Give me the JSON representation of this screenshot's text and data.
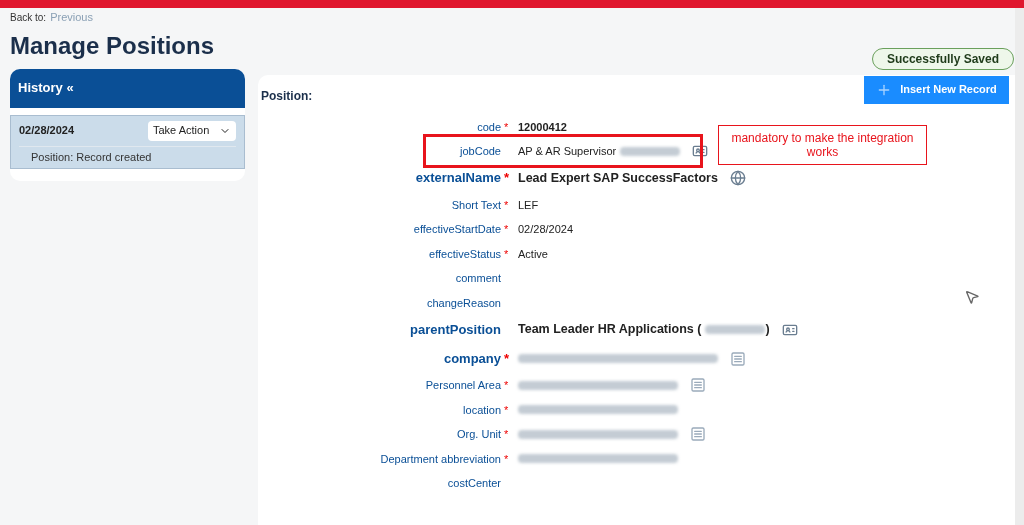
{
  "back_link": {
    "prefix": "Back to:",
    "link": "Previous"
  },
  "page_title": "Manage Positions",
  "history": {
    "title": "History «",
    "records": [
      {
        "date": "02/28/2024",
        "action_button": "Take Action",
        "note": "Position: Record created",
        "selected": true
      }
    ]
  },
  "status_badge": "Successfully Saved",
  "insert_button": "Insert New Record",
  "position": {
    "title": "Position:",
    "fields": [
      {
        "kind": "key",
        "label": "code",
        "required_mark": "*",
        "value": "12000412"
      },
      {
        "kind": "plain",
        "label": "jobCode",
        "value": "AP & AR Supervisor",
        "redacted": true,
        "highlighted": true
      },
      {
        "kind": "emphasis",
        "label": "externalName",
        "required_mark": "*",
        "value": "Lead Expert SAP SuccessFactors"
      },
      {
        "kind": "plain",
        "label": "Short Text",
        "required_mark": "*",
        "value": "LEF"
      },
      {
        "kind": "plain",
        "label": "effectiveStartDate",
        "required_mark": "*",
        "value": "02/28/2024"
      },
      {
        "kind": "plain",
        "label": "effectiveStatus",
        "required_mark": "*",
        "value": "Active"
      },
      {
        "kind": "plain",
        "label": "comment"
      },
      {
        "kind": "plain",
        "label": "changeReason"
      },
      {
        "kind": "emphasis",
        "label": "parentPosition",
        "value": "Team Leader HR Applications (",
        "redacted": true,
        "suffix": ")"
      },
      {
        "kind": "emphasis",
        "label": "company",
        "required_mark": "*",
        "redacted": true
      },
      {
        "kind": "plain",
        "label": "Personnel Area",
        "required_mark": "*",
        "redacted": true
      },
      {
        "kind": "plain",
        "label": "location",
        "required_mark": "*",
        "redacted": true
      },
      {
        "kind": "plain",
        "label": "Org. Unit",
        "required_mark": "*",
        "redacted": true
      },
      {
        "kind": "plain",
        "label": "Department abbreviation",
        "required_mark": "*",
        "redacted": true
      },
      {
        "kind": "plain",
        "label": "costCenter"
      }
    ]
  },
  "annotation": "mandatory to make the integration works"
}
